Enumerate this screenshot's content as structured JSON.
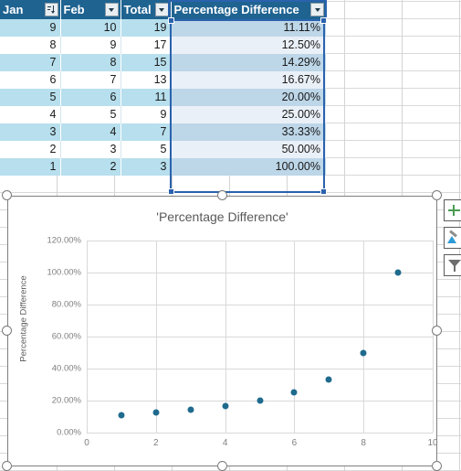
{
  "table": {
    "columns": [
      {
        "label": "Jan",
        "filter_icon": "sort-descending-filter-icon"
      },
      {
        "label": "Feb",
        "filter_icon": "filter-dropdown-icon"
      },
      {
        "label": "Total",
        "filter_icon": "filter-dropdown-icon"
      },
      {
        "label": "Percentage Difference",
        "filter_icon": "filter-dropdown-icon"
      }
    ],
    "rows": [
      {
        "jan": "9",
        "feb": "10",
        "total": "19",
        "pct": "11.11%"
      },
      {
        "jan": "8",
        "feb": "9",
        "total": "17",
        "pct": "12.50%"
      },
      {
        "jan": "7",
        "feb": "8",
        "total": "15",
        "pct": "14.29%"
      },
      {
        "jan": "6",
        "feb": "7",
        "total": "13",
        "pct": "16.67%"
      },
      {
        "jan": "5",
        "feb": "6",
        "total": "11",
        "pct": "20.00%"
      },
      {
        "jan": "4",
        "feb": "5",
        "total": "9",
        "pct": "25.00%"
      },
      {
        "jan": "3",
        "feb": "4",
        "total": "7",
        "pct": "33.33%"
      },
      {
        "jan": "2",
        "feb": "3",
        "total": "5",
        "pct": "50.00%"
      },
      {
        "jan": "1",
        "feb": "2",
        "total": "3",
        "pct": "100.00%"
      }
    ],
    "selected_column": "Percentage Difference",
    "header_color": "#1f6391",
    "band_color": "#b7dfed",
    "selection_color": "#2a62ad"
  },
  "chart_buttons": [
    {
      "name": "chart-elements-button",
      "icon": "plus-icon"
    },
    {
      "name": "chart-styles-button",
      "icon": "brush-icon"
    },
    {
      "name": "chart-filters-button",
      "icon": "funnel-icon"
    }
  ],
  "chart_data": {
    "type": "scatter",
    "title": "'Percentage Difference'",
    "xlabel": "",
    "ylabel": "Percentage Difference",
    "x": [
      1,
      2,
      3,
      4,
      5,
      6,
      7,
      8,
      9
    ],
    "values": [
      11.11,
      12.5,
      14.29,
      16.67,
      20.0,
      25.0,
      33.33,
      50.0,
      100.0
    ],
    "xlim": [
      0,
      10
    ],
    "ylim": [
      0,
      120
    ],
    "xticks": [
      "0",
      "2",
      "4",
      "6",
      "8",
      "10"
    ],
    "xtick_values": [
      0,
      2,
      4,
      6,
      8,
      10
    ],
    "yticks": [
      "0.00%",
      "20.00%",
      "40.00%",
      "60.00%",
      "80.00%",
      "100.00%",
      "120.00%"
    ],
    "ytick_values": [
      0,
      20,
      40,
      60,
      80,
      100,
      120
    ],
    "grid": true,
    "legend": false,
    "marker_color": "#1f6b8e",
    "marker_size": 7
  }
}
